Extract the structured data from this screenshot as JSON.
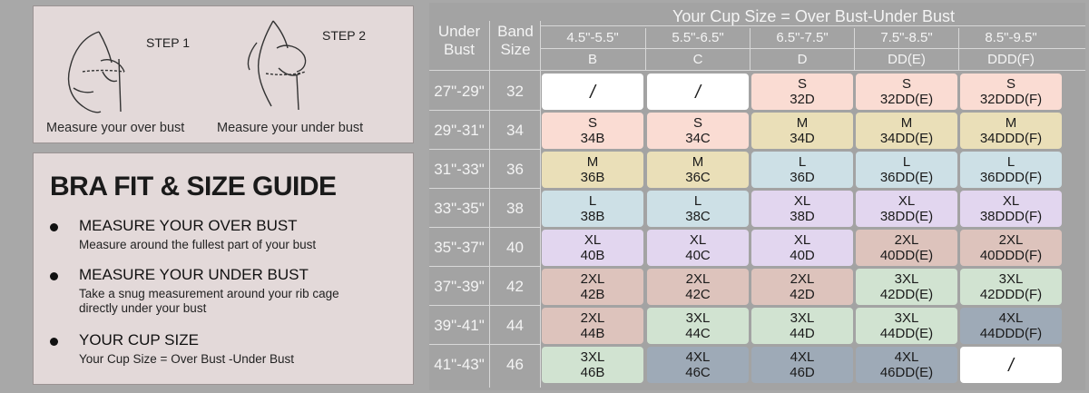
{
  "steps": {
    "step1_label": "STEP 1",
    "step2_label": "STEP 2",
    "step1_caption": "Measure your over bust",
    "step2_caption": "Measure your under bust"
  },
  "guide": {
    "title": "BRA FIT &  SIZE GUIDE",
    "items": [
      {
        "heading": "MEASURE YOUR OVER BUST",
        "desc": "Measure around the fullest part of your bust"
      },
      {
        "heading": "MEASURE YOUR UNDER BUST",
        "desc": "Take a snug measurement around your rib cage directly under your bust"
      },
      {
        "heading": "YOUR CUP SIZE",
        "desc": "Your Cup Size = Over Bust -Under Bust"
      }
    ]
  },
  "table": {
    "title": "Your Cup Size = Over Bust-Under Bust",
    "col_under": "Under Bust",
    "col_band": "Band Size",
    "cups": [
      {
        "range": "4.5\"-5.5\"",
        "cup": "B"
      },
      {
        "range": "5.5\"-6.5\"",
        "cup": "C"
      },
      {
        "range": "6.5\"-7.5\"",
        "cup": "D"
      },
      {
        "range": "7.5\"-8.5\"",
        "cup": "DD(E)"
      },
      {
        "range": "8.5\"-9.5\"",
        "cup": "DDD(F)"
      }
    ],
    "colors": {
      "white": "#ffffff",
      "pink": "#fadcd3",
      "beige": "#eadfb8",
      "blue": "#cde0e6",
      "lavender": "#e2d6ef",
      "rose": "#ddc3bc",
      "green": "#d1e3d1",
      "slate": "#9eaab7"
    },
    "rows": [
      {
        "under": "27\"-29\"",
        "band": "32",
        "cells": [
          {
            "size": "/",
            "code": "",
            "color": "white"
          },
          {
            "size": "/",
            "code": "",
            "color": "white"
          },
          {
            "size": "S",
            "code": "32D",
            "color": "pink"
          },
          {
            "size": "S",
            "code": "32DD(E)",
            "color": "pink"
          },
          {
            "size": "S",
            "code": "32DDD(F)",
            "color": "pink"
          }
        ]
      },
      {
        "under": "29\"-31\"",
        "band": "34",
        "cells": [
          {
            "size": "S",
            "code": "34B",
            "color": "pink"
          },
          {
            "size": "S",
            "code": "34C",
            "color": "pink"
          },
          {
            "size": "M",
            "code": "34D",
            "color": "beige"
          },
          {
            "size": "M",
            "code": "34DD(E)",
            "color": "beige"
          },
          {
            "size": "M",
            "code": "34DDD(F)",
            "color": "beige"
          }
        ]
      },
      {
        "under": "31\"-33\"",
        "band": "36",
        "cells": [
          {
            "size": "M",
            "code": "36B",
            "color": "beige"
          },
          {
            "size": "M",
            "code": "36C",
            "color": "beige"
          },
          {
            "size": "L",
            "code": "36D",
            "color": "blue"
          },
          {
            "size": "L",
            "code": "36DD(E)",
            "color": "blue"
          },
          {
            "size": "L",
            "code": "36DDD(F)",
            "color": "blue"
          }
        ]
      },
      {
        "under": "33\"-35\"",
        "band": "38",
        "cells": [
          {
            "size": "L",
            "code": "38B",
            "color": "blue"
          },
          {
            "size": "L",
            "code": "38C",
            "color": "blue"
          },
          {
            "size": "XL",
            "code": "38D",
            "color": "lavender"
          },
          {
            "size": "XL",
            "code": "38DD(E)",
            "color": "lavender"
          },
          {
            "size": "XL",
            "code": "38DDD(F)",
            "color": "lavender"
          }
        ]
      },
      {
        "under": "35\"-37\"",
        "band": "40",
        "cells": [
          {
            "size": "XL",
            "code": "40B",
            "color": "lavender"
          },
          {
            "size": "XL",
            "code": "40C",
            "color": "lavender"
          },
          {
            "size": "XL",
            "code": "40D",
            "color": "lavender"
          },
          {
            "size": "2XL",
            "code": "40DD(E)",
            "color": "rose"
          },
          {
            "size": "2XL",
            "code": "40DDD(F)",
            "color": "rose"
          }
        ]
      },
      {
        "under": "37\"-39\"",
        "band": "42",
        "cells": [
          {
            "size": "2XL",
            "code": "42B",
            "color": "rose"
          },
          {
            "size": "2XL",
            "code": "42C",
            "color": "rose"
          },
          {
            "size": "2XL",
            "code": "42D",
            "color": "rose"
          },
          {
            "size": "3XL",
            "code": "42DD(E)",
            "color": "green"
          },
          {
            "size": "3XL",
            "code": "42DDD(F)",
            "color": "green"
          }
        ]
      },
      {
        "under": "39\"-41\"",
        "band": "44",
        "cells": [
          {
            "size": "2XL",
            "code": "44B",
            "color": "rose"
          },
          {
            "size": "3XL",
            "code": "44C",
            "color": "green"
          },
          {
            "size": "3XL",
            "code": "44D",
            "color": "green"
          },
          {
            "size": "3XL",
            "code": "44DD(E)",
            "color": "green"
          },
          {
            "size": "4XL",
            "code": "44DDD(F)",
            "color": "slate"
          }
        ]
      },
      {
        "under": "41\"-43\"",
        "band": "46",
        "cells": [
          {
            "size": "3XL",
            "code": "46B",
            "color": "green"
          },
          {
            "size": "4XL",
            "code": "46C",
            "color": "slate"
          },
          {
            "size": "4XL",
            "code": "46D",
            "color": "slate"
          },
          {
            "size": "4XL",
            "code": "46DD(E)",
            "color": "slate"
          },
          {
            "size": "/",
            "code": "",
            "color": "white"
          }
        ]
      }
    ]
  }
}
